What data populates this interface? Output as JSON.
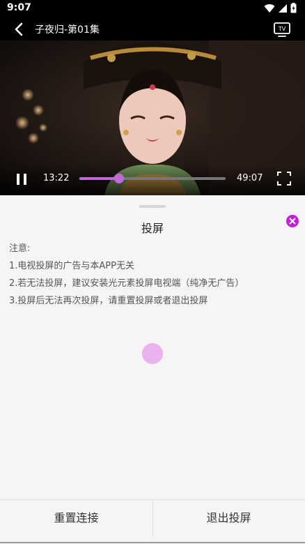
{
  "status_bar": {
    "time": "9:07"
  },
  "title_bar": {
    "title": "子夜归-第01集"
  },
  "player": {
    "current_time": "13:22",
    "total_time": "49:07",
    "progress": 0.27,
    "accent_color": "#c06ad8"
  },
  "cast_sheet": {
    "title": "投屏",
    "notes": [
      "注意:",
      "1.电视投屏的广告与本APP无关",
      "2.若无法投屏，建议安装光元素投屏电视端（纯净无广告）",
      "3.投屏后无法再次投屏，请重置投屏或者退出投屏"
    ],
    "reset_label": "重置连接",
    "exit_label": "退出投屏"
  },
  "icons": [
    "wifi-icon",
    "signal-icon",
    "battery-icon",
    "back-icon",
    "tv-icon",
    "pause-icon",
    "fullscreen-icon",
    "close-icon",
    "loading-spinner"
  ]
}
